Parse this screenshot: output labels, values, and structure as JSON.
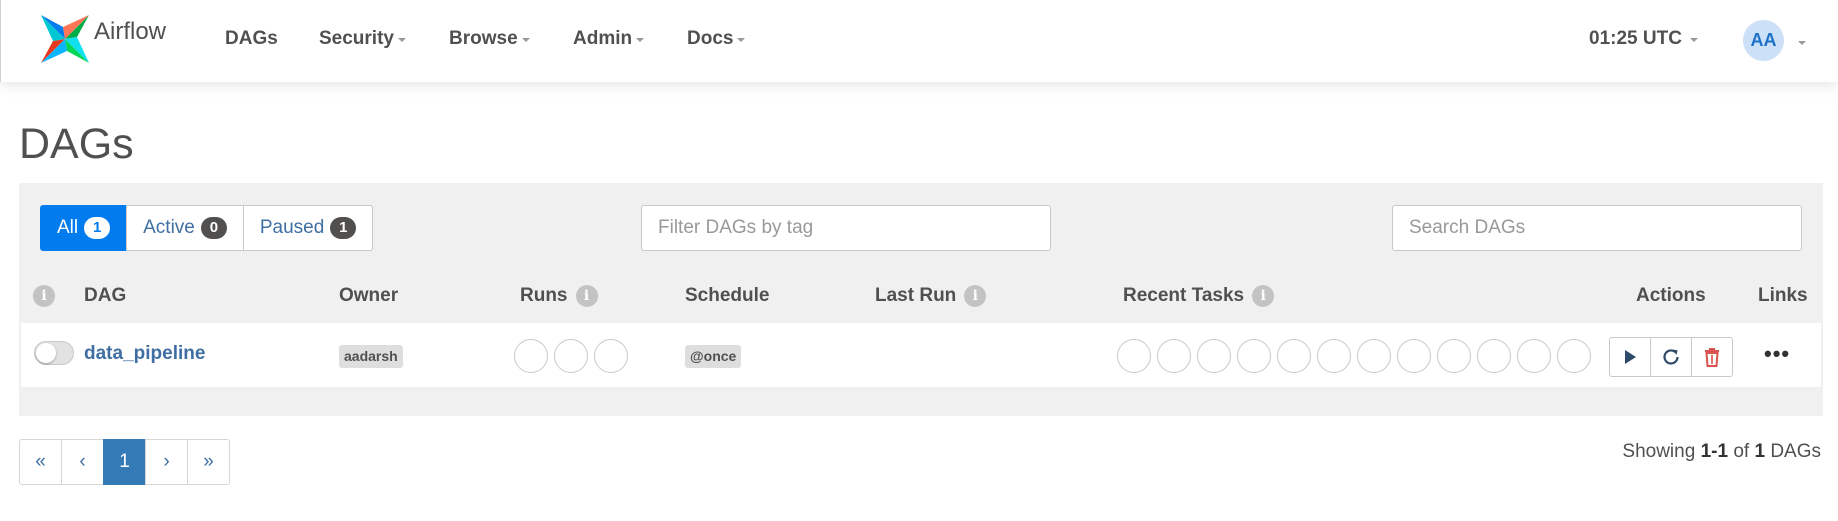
{
  "brand": {
    "name": "Airflow"
  },
  "nav": {
    "items": [
      {
        "label": "DAGs"
      },
      {
        "label": "Security"
      },
      {
        "label": "Browse"
      },
      {
        "label": "Admin"
      },
      {
        "label": "Docs"
      }
    ],
    "time": "01:25 UTC",
    "user_initials": "AA"
  },
  "page": {
    "title": "DAGs"
  },
  "filters": {
    "all": {
      "label": "All",
      "count": "1"
    },
    "active": {
      "label": "Active",
      "count": "0"
    },
    "paused": {
      "label": "Paused",
      "count": "1"
    },
    "tag_placeholder": "Filter DAGs by tag",
    "search_placeholder": "Search DAGs"
  },
  "table": {
    "columns": [
      "DAG",
      "Owner",
      "Runs",
      "Schedule",
      "Last Run",
      "Recent Tasks",
      "Actions",
      "Links"
    ],
    "rows": [
      {
        "dag_id": "data_pipeline",
        "owner": "aadarsh",
        "schedule": "@once",
        "last_run": "",
        "paused": true,
        "run_states": 3,
        "task_states": 12
      }
    ],
    "links_more": "•••"
  },
  "pagination": {
    "first": "«",
    "prev": "‹",
    "current": "1",
    "next": "›",
    "last": "»"
  },
  "showing": {
    "prefix": "Showing",
    "range": "1-1",
    "of": "of",
    "total": "1",
    "suffix": "DAGs"
  },
  "colors": {
    "primary": "#017cee",
    "link": "#3f6fa3",
    "delete": "#d9534f"
  }
}
